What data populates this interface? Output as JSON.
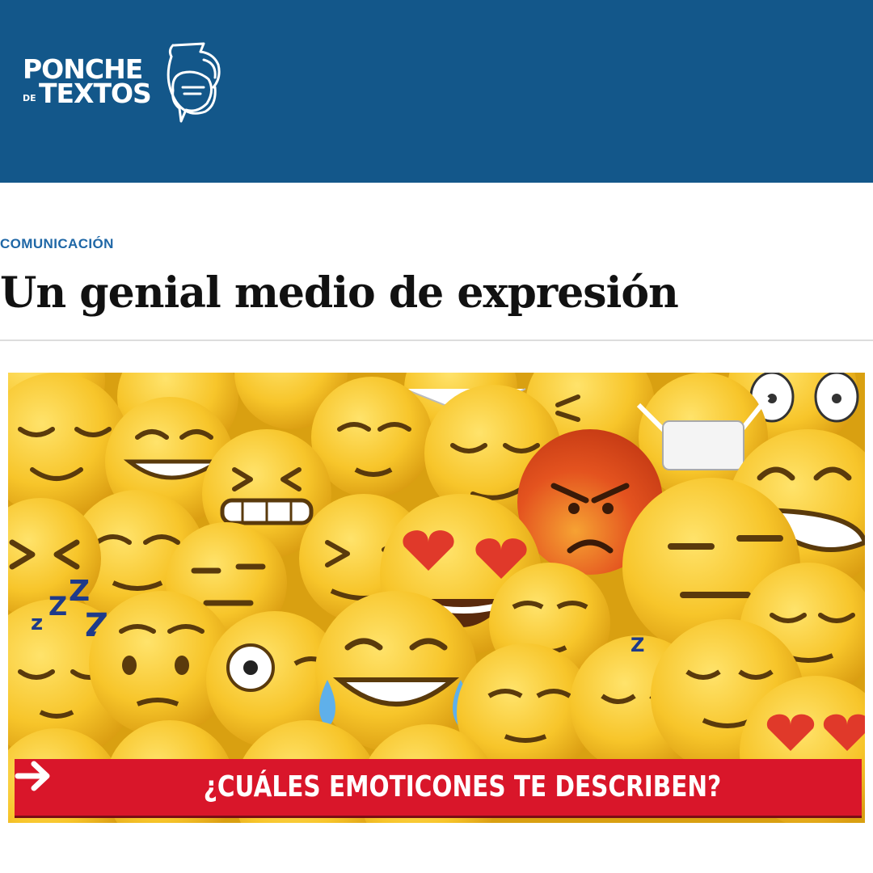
{
  "logo": {
    "line1": "PONCHE",
    "small": "DE",
    "line2": "TEXTOS",
    "icon": "pitcher-speech-bubble-icon"
  },
  "article": {
    "category": "COMUNICACIÓN",
    "title": "Un genial medio de expresión"
  },
  "hero": {
    "banner_text": "¿CUÁLES EMOTICONES TE DESCRIBEN?",
    "arrow_icon": "arrow-right-icon",
    "colors": {
      "header": "#13578a",
      "banner": "#d9162a",
      "emoji": "#f7c52a",
      "angry": "#e4531f",
      "category": "#1f67a6"
    }
  }
}
